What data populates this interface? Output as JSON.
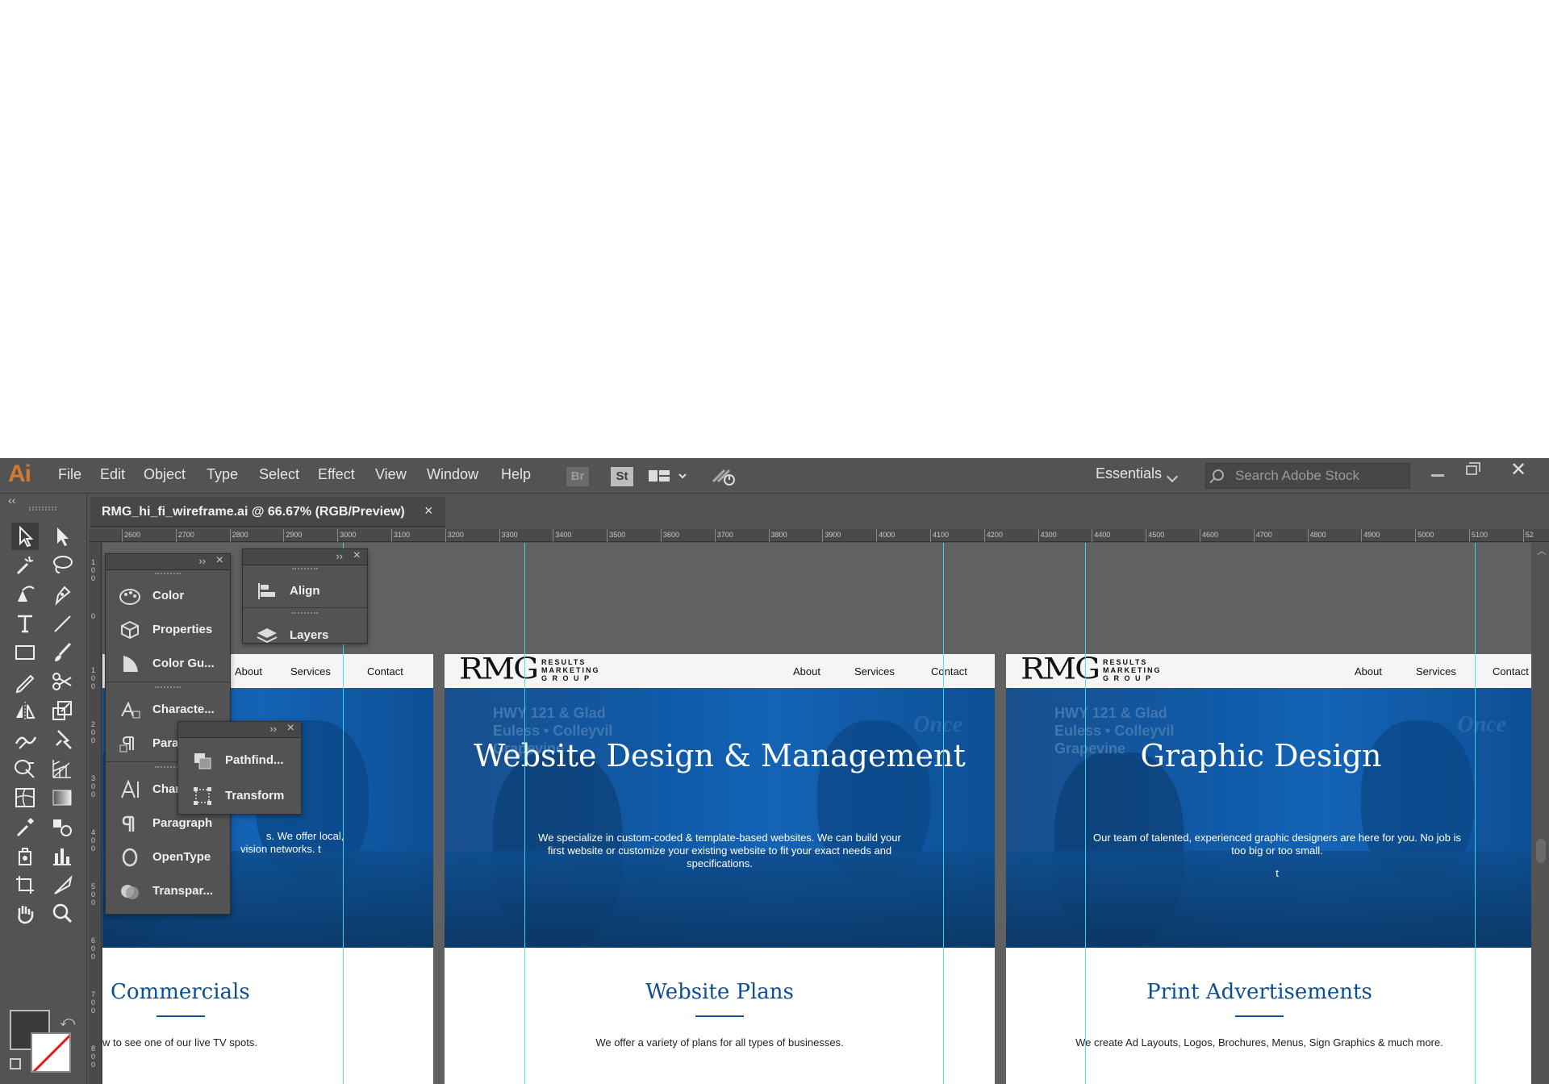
{
  "app": {
    "logo": "Ai",
    "menu": [
      "File",
      "Edit",
      "Object",
      "Type",
      "Select",
      "Effect",
      "View",
      "Window",
      "Help"
    ],
    "bridge_label": "Br",
    "stock_label": "St",
    "workspace": "Essentials",
    "search_placeholder": "Search Adobe Stock"
  },
  "document": {
    "tab_title": "RMG_hi_fi_wireframe.ai @ 66.67% (RGB/Preview)",
    "close": "×"
  },
  "ruler": {
    "h_ticks": [
      "2600",
      "2700",
      "2800",
      "2900",
      "3000",
      "3100",
      "3200",
      "3300",
      "3400",
      "3500",
      "3600",
      "3700",
      "3800",
      "3900",
      "4000",
      "4100",
      "4200",
      "4300",
      "4400",
      "4500",
      "4600",
      "4700",
      "4800",
      "4900",
      "5000",
      "5100",
      "52"
    ],
    "v_ticks": [
      "100",
      "0",
      "100",
      "200",
      "300",
      "400",
      "500",
      "600",
      "700",
      "800"
    ]
  },
  "panels": {
    "group1": [
      "Color",
      "Properties",
      "Color Gu...",
      "Characte...",
      "Para...",
      "Char...",
      "Paragraph",
      "OpenType",
      "Transpar..."
    ],
    "group2": [
      "Align",
      "Layers"
    ],
    "group3": [
      "Pathfind...",
      "Transform"
    ]
  },
  "artboards": [
    {
      "nav": [
        "About",
        "Services",
        "Contact"
      ],
      "hero_text": "...s. We offer local, ...vision networks. t",
      "hero_line1": "s. We offer local,",
      "hero_line2": "vision networks. t",
      "section_title": "Commercials",
      "section_text": "w to see one of our live TV spots."
    },
    {
      "logo": "RMG",
      "logo_sub": [
        "RESULTS",
        "MARKETING",
        "G R O U P"
      ],
      "nav": [
        "About",
        "Services",
        "Contact"
      ],
      "sign": [
        "HWY 121 & Glad",
        "Euless • Colleyvil",
        "Grapevine"
      ],
      "sign2": "Once",
      "hero_title": "Website Design & Management",
      "hero_text": "We specialize in custom-coded & template-based websites. We can build your first website or customize your existing website to fit your exact needs and specifications.",
      "section_title": "Website Plans",
      "section_text": "We offer a variety of plans for all types of businesses."
    },
    {
      "logo": "RMG",
      "logo_sub": [
        "RESULTS",
        "MARKETING",
        "G R O U P"
      ],
      "nav": [
        "About",
        "Services",
        "Contact"
      ],
      "sign": [
        "HWY 121 & Glad",
        "Euless • Colleyvil",
        "Grapevine"
      ],
      "sign2": "Once",
      "hero_title": "Graphic Design",
      "hero_text": "Our team of talented, experienced graphic designers are here for you. No job is too big or too small.",
      "hero_extra": "t",
      "section_title": "Print Advertisements",
      "section_text": "We create Ad Layouts, Logos, Brochures, Menus, Sign Graphics & much more."
    }
  ],
  "colors": {
    "brand_blue": "#0d4f95",
    "guide": "#3fe0e8",
    "chrome": "#535353"
  }
}
